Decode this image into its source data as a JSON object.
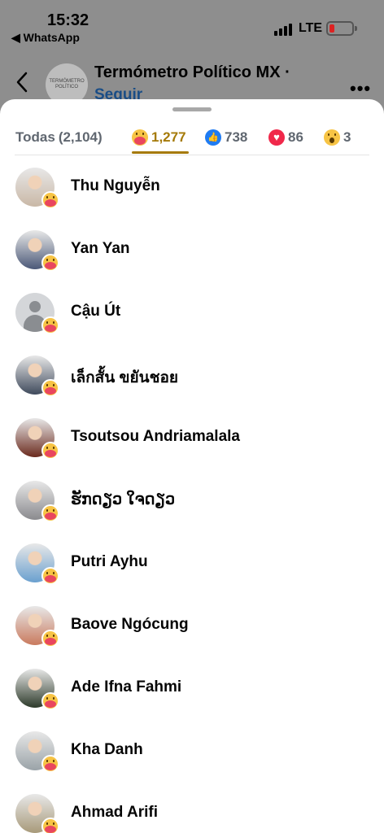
{
  "status_bar": {
    "time": "15:32",
    "back_app": "◀ WhatsApp",
    "network": "LTE"
  },
  "page_header": {
    "logo_text": "TERMÓMETRO POLÍTICO",
    "name": "Termómetro Político MX ·",
    "follow": "Seguir",
    "more": "•••"
  },
  "tabs": [
    {
      "label": "Todas",
      "count": "(2,104)",
      "icon": null
    },
    {
      "label": "",
      "count": "1,277",
      "icon": "care-reaction-icon"
    },
    {
      "label": "",
      "count": "738",
      "icon": "like-reaction-icon"
    },
    {
      "label": "",
      "count": "86",
      "icon": "love-reaction-icon"
    },
    {
      "label": "",
      "count": "3",
      "icon": "wow-reaction-icon"
    }
  ],
  "reactors": [
    {
      "name": "Thu Nguyễn",
      "avatar_color": "#c9b8a6"
    },
    {
      "name": "Yan Yan",
      "avatar_color": "#4b5878"
    },
    {
      "name": "Cậu Út",
      "avatar_color": "default"
    },
    {
      "name": "เล็กสั้น ขยันชอย",
      "avatar_color": "#3f4a5c"
    },
    {
      "name": "Tsoutsou Andriamalala",
      "avatar_color": "#6b2a1e"
    },
    {
      "name": "ຮັກດຽວ ໃຈດຽວ",
      "avatar_color": "#8a8a8e"
    },
    {
      "name": "Putri Ayhu",
      "avatar_color": "#6aa0cf"
    },
    {
      "name": "Baove Ngócung",
      "avatar_color": "#c97a5e"
    },
    {
      "name": "Ade Ifna Fahmi",
      "avatar_color": "#2d3a2a"
    },
    {
      "name": "Kha Danh",
      "avatar_color": "#9aa3a8"
    },
    {
      "name": "Ahmad Arifi",
      "avatar_color": "#a89a7a"
    }
  ],
  "colors": {
    "active_tab": "#a57a08",
    "link": "#1a4d86"
  }
}
